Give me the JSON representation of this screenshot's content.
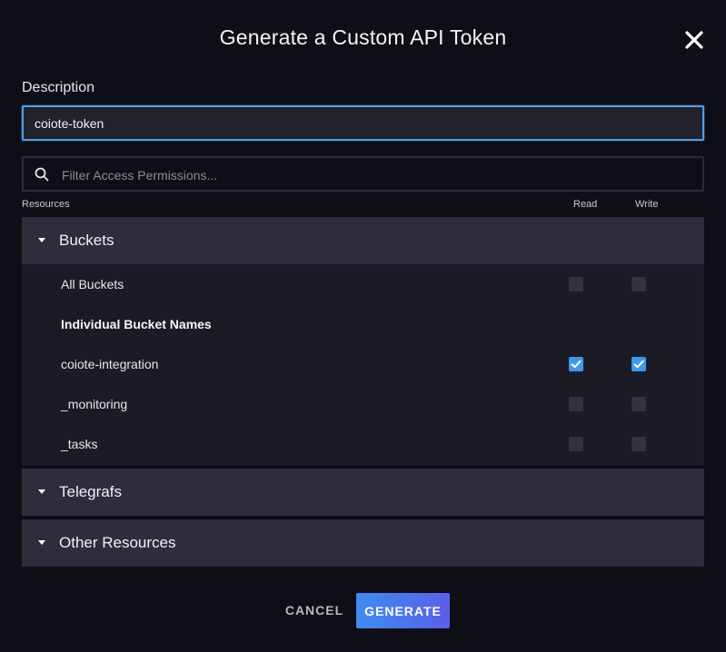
{
  "dialog": {
    "title": "Generate a Custom API Token",
    "description_label": "Description",
    "description_value": "coiote-token",
    "filter_placeholder": "Filter Access Permissions..."
  },
  "columns": {
    "resources": "Resources",
    "read": "Read",
    "write": "Write"
  },
  "sections": [
    {
      "label": "Buckets",
      "expanded": true,
      "all_label": "All Buckets",
      "all_read": false,
      "all_write": false,
      "subheading": "Individual Bucket Names",
      "items": [
        {
          "name": "coiote-integration",
          "read": true,
          "write": true
        },
        {
          "name": "_monitoring",
          "read": false,
          "write": false
        },
        {
          "name": "_tasks",
          "read": false,
          "write": false
        }
      ]
    },
    {
      "label": "Telegrafs",
      "expanded": false
    },
    {
      "label": "Other Resources",
      "expanded": false
    }
  ],
  "footer": {
    "cancel_label": "CANCEL",
    "generate_label": "GENERATE"
  },
  "icons": {
    "close": "close-icon",
    "search": "search-icon",
    "caret": "caret-down-icon",
    "check": "checkmark-icon"
  },
  "colors": {
    "background": "#0e0e16",
    "section_header": "#2d2d3c",
    "section_body": "#1b1b26",
    "focus_border": "#4f9fe8",
    "checkbox_checked": "#3f98ea",
    "generate_gradient_start": "#3d8df0",
    "generate_gradient_end": "#5b5fe8"
  }
}
